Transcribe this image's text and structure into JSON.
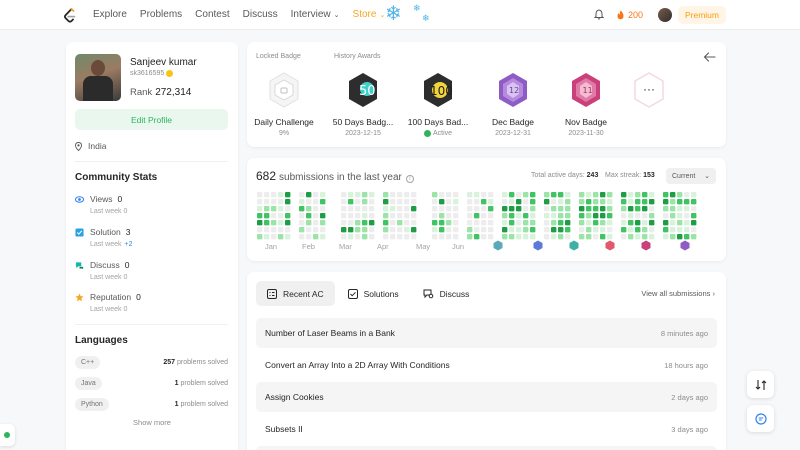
{
  "nav": {
    "links": [
      "Explore",
      "Problems",
      "Contest",
      "Discuss",
      "Interview",
      "Store"
    ],
    "coins": "200",
    "premium": "Premium"
  },
  "profile": {
    "name": "Sanjeev kumar",
    "username": "sk3616595",
    "rank_label": "Rank",
    "rank_value": "272,314",
    "edit_label": "Edit Profile",
    "location": "India"
  },
  "community": {
    "title": "Community Stats",
    "items": [
      {
        "label": "Views",
        "value": "0",
        "sub": "Last week",
        "delta": "0",
        "color": "#2f80ed",
        "icon": "eye-icon"
      },
      {
        "label": "Solution",
        "value": "3",
        "sub": "Last week",
        "delta": "+2",
        "color": "#29a3e0",
        "icon": "checkbox-icon"
      },
      {
        "label": "Discuss",
        "value": "0",
        "sub": "Last week",
        "delta": "0",
        "color": "#14b8a6",
        "icon": "chat-icon"
      },
      {
        "label": "Reputation",
        "value": "0",
        "sub": "Last week",
        "delta": "0",
        "color": "#f5a623",
        "icon": "star-icon"
      }
    ]
  },
  "languages": {
    "title": "Languages",
    "items": [
      {
        "name": "C++",
        "count": "257",
        "suffix": "problems solved"
      },
      {
        "name": "Java",
        "count": "1",
        "suffix": "problem solved"
      },
      {
        "name": "Python",
        "count": "1",
        "suffix": "problem solved"
      }
    ],
    "show_more": "Show more"
  },
  "badges": {
    "locked_label": "Locked Badge",
    "history_label": "History Awards",
    "items": [
      {
        "name": "Daily Challenge",
        "date": "9%",
        "color": "#d9d9d9",
        "kind": "locked"
      },
      {
        "name": "50 Days Badg...",
        "date": "2023-12-15",
        "color": "#2d2d2d",
        "kind": "50"
      },
      {
        "name": "100 Days Bad...",
        "date": "Active",
        "color": "#2d2d2d",
        "kind": "100"
      },
      {
        "name": "Dec Badge",
        "date": "2023-12-31",
        "color": "#8e5cc4",
        "kind": "dec"
      },
      {
        "name": "Nov Badge",
        "date": "2023-11-30",
        "color": "#c9407a",
        "kind": "nov"
      }
    ],
    "more": "···"
  },
  "submissions": {
    "count": "682",
    "label": "submissions in the last year",
    "active_days_label": "Total active days:",
    "active_days": "243",
    "max_streak_label": "Max streak:",
    "max_streak": "153",
    "period": "Current",
    "months": [
      "Jan",
      "Feb",
      "Mar",
      "Apr",
      "May",
      "Jun"
    ]
  },
  "recent": {
    "tabs": [
      "Recent AC",
      "Solutions",
      "Discuss"
    ],
    "view_all": "View all submissions",
    "rows": [
      {
        "title": "Number of Laser Beams in a Bank",
        "time": "8 minutes ago"
      },
      {
        "title": "Convert an Array Into a 2D Array With Conditions",
        "time": "18 hours ago"
      },
      {
        "title": "Assign Cookies",
        "time": "2 days ago"
      },
      {
        "title": "Subsets II",
        "time": "3 days ago"
      }
    ]
  }
}
